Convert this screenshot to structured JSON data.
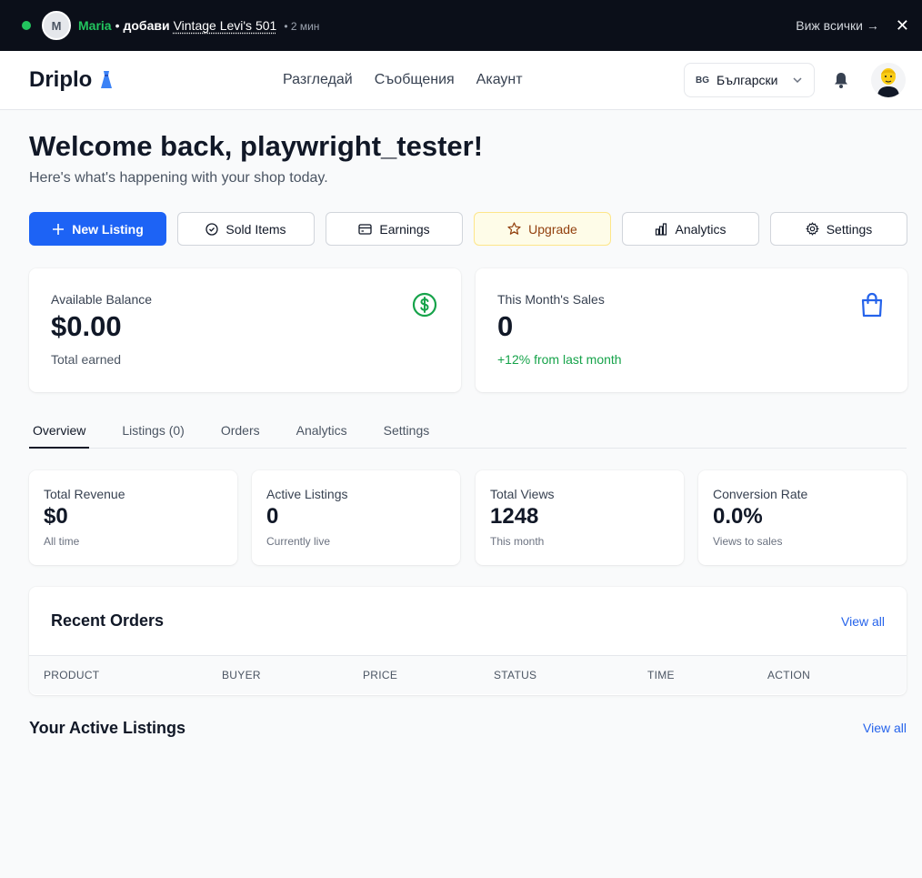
{
  "notification": {
    "avatar_initial": "M",
    "user": "Maria",
    "separator": "•",
    "action": "добави",
    "item": "Vintage Levi's 501",
    "time": "• 2 мин",
    "view_all": "Виж всички →",
    "close": "✕"
  },
  "header": {
    "logo": "Driplo",
    "nav": [
      "Разгледай",
      "Съобщения",
      "Акаунт"
    ],
    "lang_code": "BG",
    "lang_label": "Български"
  },
  "welcome": {
    "title": "Welcome back, playwright_tester!",
    "subtitle": "Here's what's happening with your shop today."
  },
  "actions": [
    {
      "label": "New Listing",
      "icon": "plus-icon"
    },
    {
      "label": "Sold Items",
      "icon": "check-circle-icon"
    },
    {
      "label": "Earnings",
      "icon": "credit-card-icon"
    },
    {
      "label": "Upgrade",
      "icon": "star-icon"
    },
    {
      "label": "Analytics",
      "icon": "bar-chart-icon"
    },
    {
      "label": "Settings",
      "icon": "gear-icon"
    }
  ],
  "balance": {
    "label": "Available Balance",
    "value": "$0.00",
    "note": "Total earned"
  },
  "month_sales": {
    "label": "This Month's Sales",
    "value": "0",
    "note": "+12% from last month"
  },
  "tabs": [
    "Overview",
    "Listings (0)",
    "Orders",
    "Analytics",
    "Settings"
  ],
  "stats": [
    {
      "label": "Total Revenue",
      "value": "$0",
      "note": "All time"
    },
    {
      "label": "Active Listings",
      "value": "0",
      "note": "Currently live"
    },
    {
      "label": "Total Views",
      "value": "1248",
      "note": "This month"
    },
    {
      "label": "Conversion Rate",
      "value": "0.0%",
      "note": "Views to sales"
    }
  ],
  "orders": {
    "title": "Recent Orders",
    "view_all": "View all",
    "columns": [
      "Product",
      "Buyer",
      "Price",
      "Status",
      "Time",
      "Action"
    ]
  },
  "active_listings": {
    "title": "Your Active Listings",
    "view_all": "View all"
  },
  "colors": {
    "primary": "#1d63f5",
    "success": "#16a34a",
    "notif_bg": "#0b0f19"
  }
}
